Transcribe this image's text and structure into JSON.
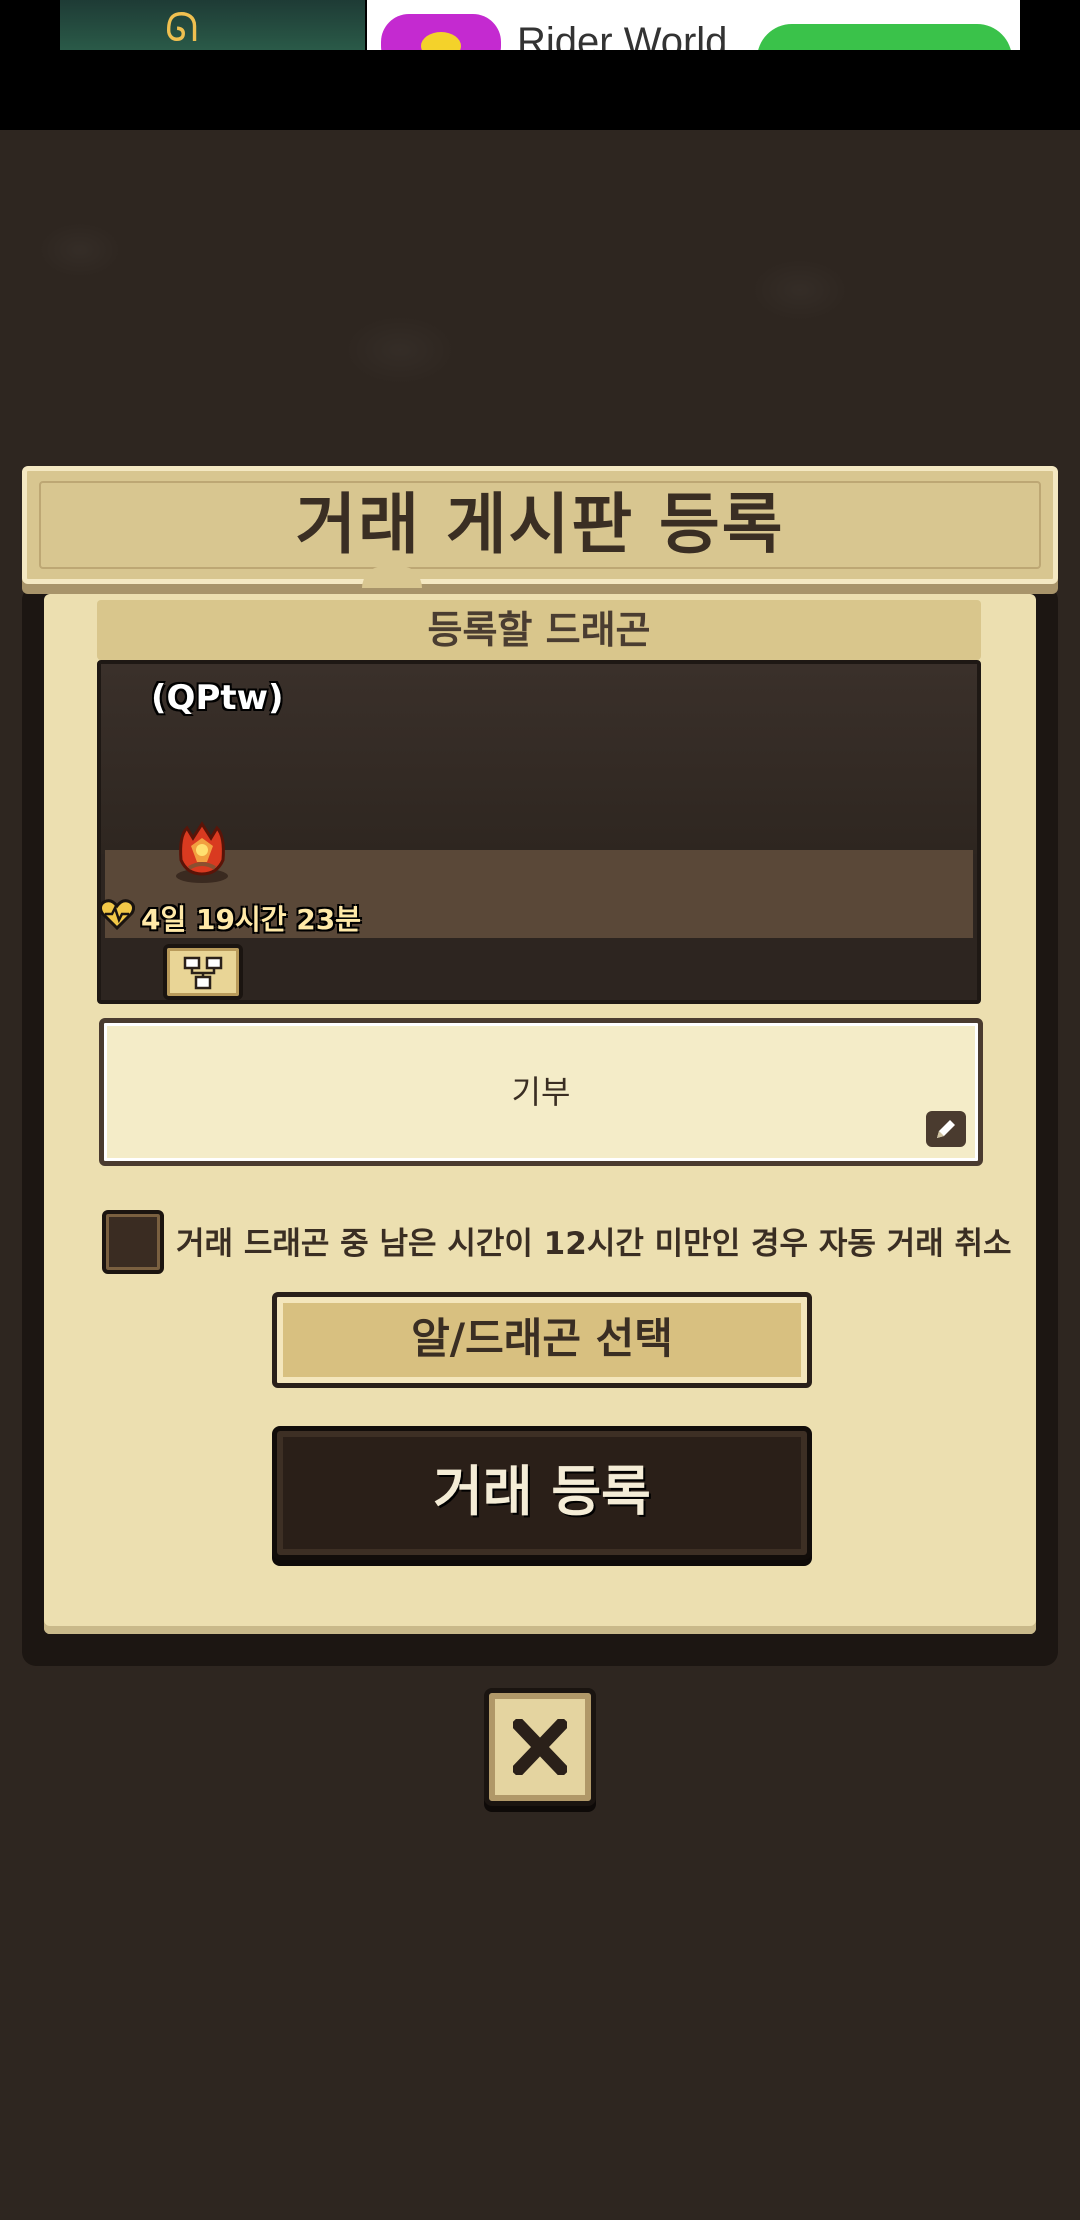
{
  "ad": {
    "app_name": "Rider World"
  },
  "modal": {
    "title": "거래 게시판 등록",
    "section_title": "등록할 드래곤",
    "dragon": {
      "name": "(QPtw)",
      "time_remaining": "4일 19시간 23분"
    },
    "memo_text": "기부",
    "auto_cancel_label": "거래 드래곤 중 남은 시간이 12시간 미만인 경우 자동 거래 취소",
    "auto_cancel_checked": false,
    "select_button_label": "알/드래곤 선택",
    "register_button_label": "거래 등록"
  },
  "icons": {
    "heart": "heart-icon",
    "family_tree": "family-tree-icon",
    "edit": "pencil-icon",
    "close": "close-icon"
  },
  "colors": {
    "background": "#2d2520",
    "paper": "#ecdfb0",
    "title_bar": "#d8c690",
    "dark_button": "#2a1f18",
    "timer_text": "#ffe9a8"
  }
}
